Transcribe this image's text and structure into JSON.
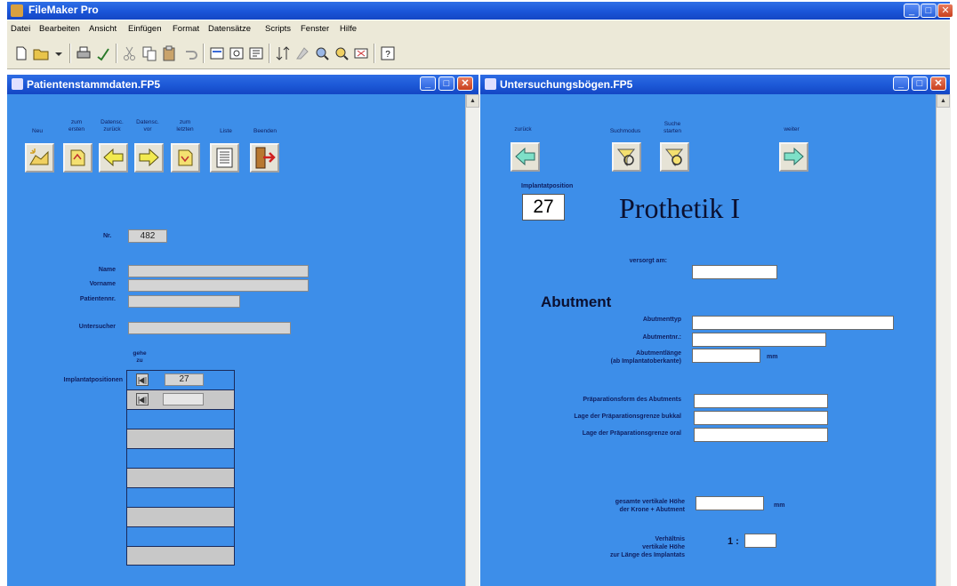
{
  "app": {
    "title": "FileMaker Pro"
  },
  "menu": [
    "Datei",
    "Bearbeiten",
    "Ansicht",
    "Einfügen",
    "Format",
    "Datensätze",
    "Scripts",
    "Fenster",
    "Hilfe"
  ],
  "left_window": {
    "title": "Patientenstammdaten.FP5",
    "buttons": [
      {
        "label": "Neu",
        "icon": "new-record-icon"
      },
      {
        "label": "zum\nersten",
        "icon": "first-record-icon"
      },
      {
        "label": "Datensc.\nzurück",
        "icon": "arrow-left-icon"
      },
      {
        "label": "Datensc.\nvor",
        "icon": "arrow-right-icon"
      },
      {
        "label": "zum\nletzten",
        "icon": "last-record-icon"
      },
      {
        "label": "Liste",
        "icon": "list-icon"
      },
      {
        "label": "Beenden",
        "icon": "exit-door-icon"
      }
    ],
    "nr_label": "Nr.",
    "nr_value": "482",
    "name_label": "Name",
    "vorname_label": "Vorname",
    "patientennr_label": "Patientennr.",
    "untersucher_label": "Untersucher",
    "gehe_zu_label": "gehe\nzu",
    "implantatpositionen_label": "Implantatpositionen",
    "implant_rows": [
      {
        "value": "27"
      },
      {
        "value": ""
      }
    ]
  },
  "right_window": {
    "title": "Untersuchungsbögen.FP5",
    "buttons": [
      {
        "label": "zurück",
        "icon": "back-arrow-icon"
      },
      {
        "label": "Suchmodus",
        "icon": "search-mode-icon"
      },
      {
        "label": "Suche\nstarten",
        "icon": "search-start-icon"
      },
      {
        "label": "weiter",
        "icon": "forward-arrow-icon"
      }
    ],
    "implantatposition_label": "Implantatposition",
    "implantatposition_value": "27",
    "heading": "Prothetik I",
    "versorgt_am_label": "versorgt am:",
    "abutment_heading": "Abutment",
    "abutmenttyp_label": "Abutmenttyp",
    "abutmentnr_label": "Abutmentnr.:",
    "abutmentlaenge_label": "Abutmentlänge\n(ab Implantatoberkante)",
    "mm_unit": "mm",
    "praeparationsform_label": "Präparationsform des Abutments",
    "lage_bukkal_label": "Lage der Präparationsgrenze bukkal",
    "lage_oral_label": "Lage der Präparationsgrenze oral",
    "gesamte_hoehe_label": "gesamte vertikale Höhe\nder Krone + Abutment",
    "verhaeltnis_label": "Verhältnis\nvertikale Höhe\nzur Länge des Implantats",
    "ratio_prefix": "1 :"
  }
}
